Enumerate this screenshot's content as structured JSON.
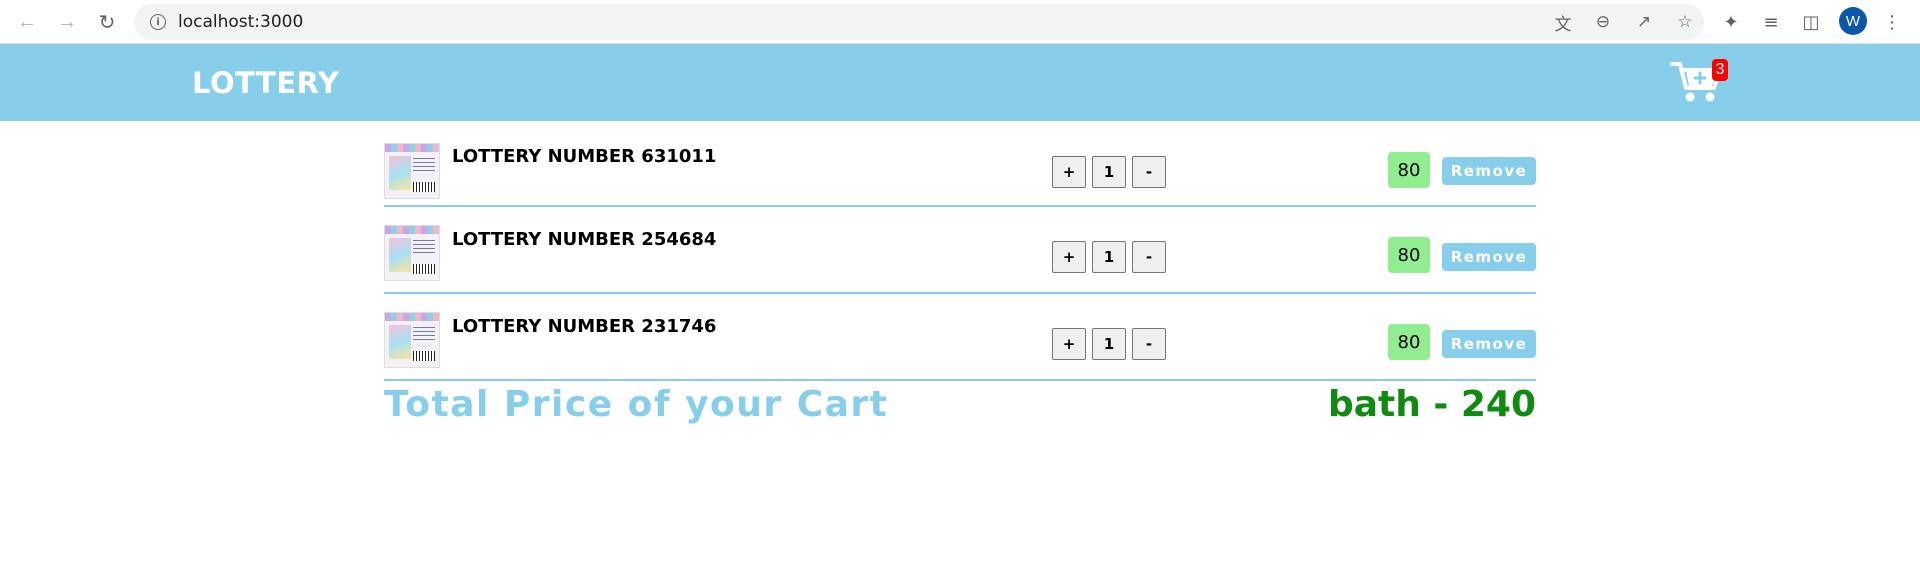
{
  "browser": {
    "url": "localhost:3000",
    "profile_initial": "W",
    "icons": [
      "back-arrow-icon",
      "forward-arrow-icon",
      "reload-icon",
      "info-icon",
      "translate-icon",
      "zoom-out-icon",
      "share-icon",
      "star-icon",
      "extensions-icon",
      "reading-list-icon",
      "side-panel-icon",
      "menu-icon"
    ]
  },
  "header": {
    "brand": "LOTTERY",
    "cart_count": "3",
    "accent_color": "#87ceeb"
  },
  "cart": {
    "items": [
      {
        "name": "LOTTERY NUMBER 631011",
        "quantity": "1",
        "price": "80",
        "plus_label": "+",
        "minus_label": "-",
        "remove_label": "Remove"
      },
      {
        "name": "LOTTERY NUMBER 254684",
        "quantity": "1",
        "price": "80",
        "plus_label": "+",
        "minus_label": "-",
        "remove_label": "Remove"
      },
      {
        "name": "LOTTERY NUMBER 231746",
        "quantity": "1",
        "price": "80",
        "plus_label": "+",
        "minus_label": "-",
        "remove_label": "Remove"
      }
    ],
    "total_label": "Total Price of your Cart",
    "total_value": "bath - 240",
    "colors": {
      "price_bg": "#90ee90",
      "total_value": "#118a11"
    }
  }
}
